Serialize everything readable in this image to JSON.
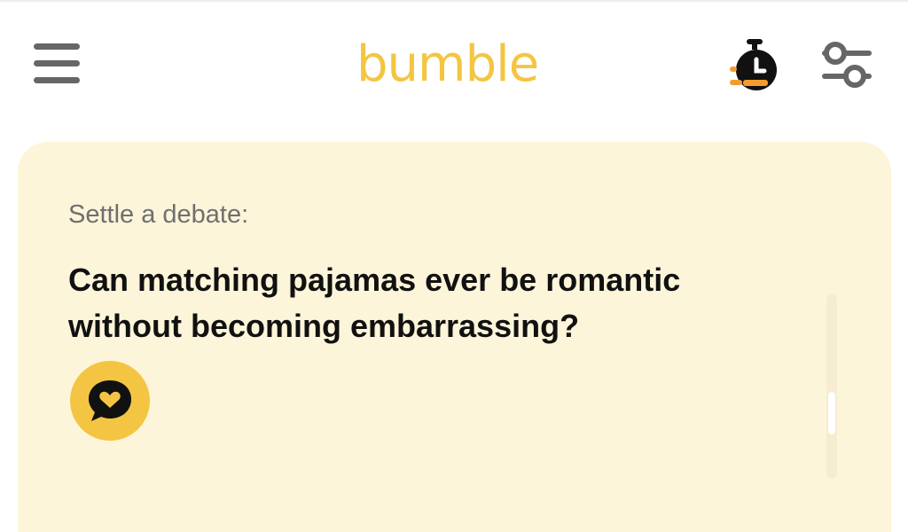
{
  "header": {
    "logo_text": "bumble",
    "menu_icon": "hamburger-menu-icon",
    "timer_icon": "stopwatch-icon",
    "filters_icon": "sliders-filter-icon"
  },
  "card": {
    "label": "Settle a debate:",
    "question": "Can matching pajamas ever be romantic without becoming embarrassing?",
    "action_icon": "chat-heart-icon"
  },
  "colors": {
    "brand_yellow": "#f4c542",
    "card_background": "#fdf5d9",
    "accent_orange": "#f39c2d",
    "icon_gray": "#666666"
  }
}
